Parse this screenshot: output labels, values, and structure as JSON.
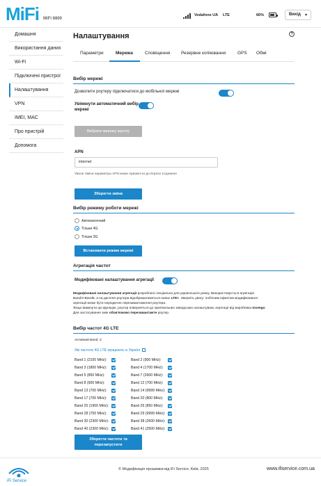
{
  "header": {
    "logo": "MiFi",
    "model": "MiFi 8800",
    "operator": "Vodafone UA",
    "network_type": "LTE",
    "battery_percent": "66%",
    "battery_level": 0.66,
    "signal_icon": "signal-bars-icon",
    "battery_icon": "battery-icon",
    "logout_label": "Вихід"
  },
  "sidebar": {
    "items": [
      {
        "label": "Домашня"
      },
      {
        "label": "Використання даних"
      },
      {
        "label": "Wi-Fi"
      },
      {
        "label": "Підключені пристрої"
      },
      {
        "label": "Налаштування"
      },
      {
        "label": "VPN"
      },
      {
        "label": "IMEI, MAC"
      },
      {
        "label": "Про пристрій"
      },
      {
        "label": "Допомога"
      }
    ],
    "active_index": 4
  },
  "main": {
    "title": "Налаштування",
    "help_icon": "help-circle-icon",
    "tabs": [
      {
        "label": "Параметри"
      },
      {
        "label": "Мережа"
      },
      {
        "label": "Сповіщення"
      },
      {
        "label": "Резервне копіювання"
      },
      {
        "label": "GPS"
      },
      {
        "label": "Обмі"
      }
    ],
    "active_tab": 1
  },
  "network_select": {
    "heading": "Вибір мережі",
    "allow_label": "Дозволити роутеру підключатися до мобільної мережі",
    "allow_enabled": true,
    "auto_label": "Увімкнути автоматичний вибір мережі",
    "auto_enabled": true,
    "manual_button": "Вибрати мережу вручну"
  },
  "apn": {
    "label": "APN",
    "value": "internet",
    "warning": "Увага! Зміна параметра APN може призвести до втрати з'єднання",
    "save_button": "Зберегти зміни"
  },
  "mode": {
    "heading": "Вибір режиму роботи мережі",
    "options": [
      "Автоматичний",
      "Тільки 4G",
      "Тільки 3G"
    ],
    "selected_index": 1,
    "button": "Встановити режим мережі"
  },
  "aggregation": {
    "heading": "Агрегація частот",
    "toggle_label": "Модифіковані налаштування агрегації",
    "enabled": true,
    "desc1_bold": "Модифіковані налаштування агрегації",
    "desc1": " розроблені спеціально для українського ринку. Використовується агрегація",
    "desc2": "Band3+Band8, а на дисплеї роутера відображатиметься напис ",
    "desc2_bold": "LTE+",
    "desc2_end": ". Зверніть увагу: побічним ефектом модифікованої",
    "desc3": "агрегації може бути періодичне перезавантаження роутера.",
    "desc4_start": "Якщо вимкнути цю функцію, роутер повернеться до оригінальних заводських налаштувань агрегації від виробника ",
    "desc4_bold": "Inseego",
    "desc4_end": ".",
    "desc5_start": "Для застосування змін ",
    "desc5_bold": "обов'язково перезавантажте",
    "desc5_end": " роутер."
  },
  "bands": {
    "heading": "Вибір частот 4G LTE",
    "active_label": "Активний Band: 3",
    "link": "Які частоти 4G LTE працюють в Україні",
    "left": [
      "Band 1 (2100 MHz):",
      "Band 3 (1800 MHz):",
      "Band 5 (850 MHz):",
      "Band 8 (900 MHz):",
      "Band 13 (700 MHz):",
      "Band 17 (700 MHz):",
      "Band 25 (1900 MHz):",
      "Band 28 (700 MHz):",
      "Band 30 (2300 MHz):",
      "Band 40 (2300 MHz):"
    ],
    "right": [
      "Band 2 (900 MHz):",
      "Band 4 (1700 MHz):",
      "Band 7 (2600 MHz):",
      "Band 12 (700 MHz):",
      "Band 14 (9999 MHz):",
      "Band 20 (800 MHz):",
      "Band 26 (850 MHz):",
      "Band 29 (9999 MHz):",
      "Band 38 (2600 MHz):",
      "Band 41 (2500 MHz):"
    ],
    "save_button_line1": "Зберегти частоти та",
    "save_button_line2": "перезапустити"
  },
  "footer": {
    "brand": "iFi Service",
    "copyright": "© Модифікація прошивки від iFi Service, Київ, 2025",
    "site": "www.ifiservice.com.ua"
  },
  "colors": {
    "accent": "#1b86c9",
    "logo": "#1aa3d9",
    "disabled_button": "#b3b3b3"
  }
}
